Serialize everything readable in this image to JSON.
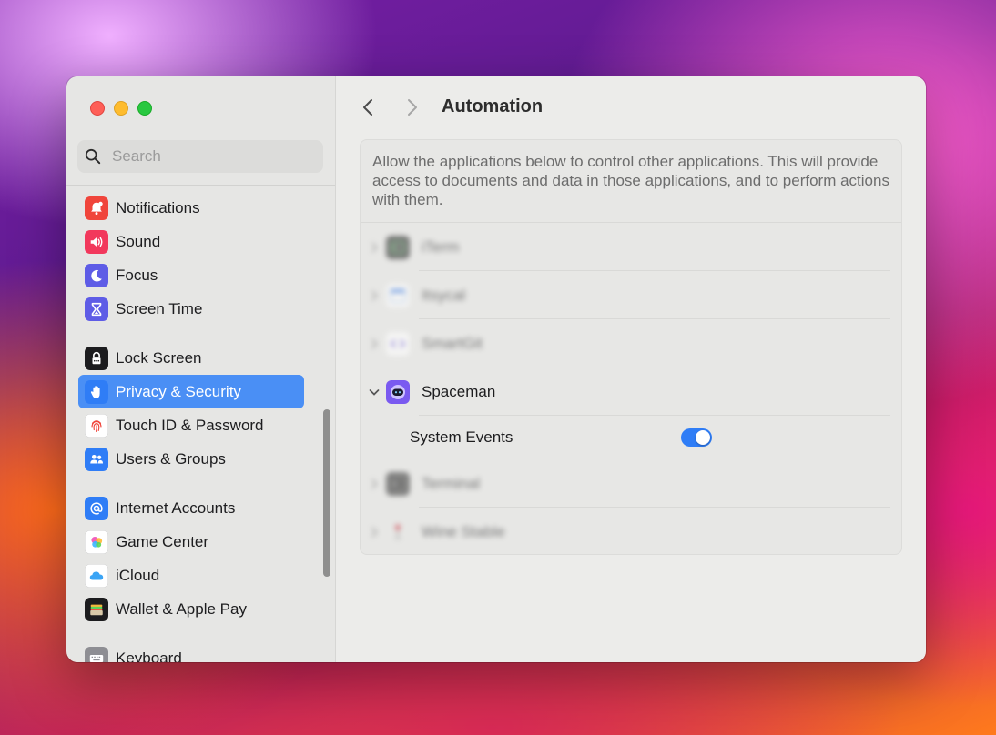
{
  "sidebar": {
    "search_placeholder": "Search",
    "items": [
      {
        "label": "Notifications",
        "icon": "bell-icon",
        "color": "#f0453b"
      },
      {
        "label": "Sound",
        "icon": "speaker-icon",
        "color": "#f2385c"
      },
      {
        "label": "Focus",
        "icon": "moon-icon",
        "color": "#5e5ce6"
      },
      {
        "label": "Screen Time",
        "icon": "hourglass-icon",
        "color": "#5e5ce6"
      },
      {
        "label": "Lock Screen",
        "icon": "lock-icon",
        "color": "#1c1c1e"
      },
      {
        "label": "Privacy & Security",
        "icon": "hand-icon",
        "color": "#2f7df6",
        "active": true
      },
      {
        "label": "Touch ID & Password",
        "icon": "fingerprint-icon",
        "color": "#ffffff"
      },
      {
        "label": "Users & Groups",
        "icon": "users-icon",
        "color": "#2f7df6"
      },
      {
        "label": "Internet Accounts",
        "icon": "at-icon",
        "color": "#2f7df6"
      },
      {
        "label": "Game Center",
        "icon": "game-center-icon",
        "color": "#ffffff"
      },
      {
        "label": "iCloud",
        "icon": "cloud-icon",
        "color": "#ffffff"
      },
      {
        "label": "Wallet & Apple Pay",
        "icon": "wallet-icon",
        "color": "#1c1c1e"
      },
      {
        "label": "Keyboard",
        "icon": "keyboard-icon",
        "color": "#8e8e93"
      }
    ]
  },
  "header": {
    "title": "Automation"
  },
  "main": {
    "description": "Allow the applications below to control other applications. This will provide access to documents and data in those applications, and to perform actions with them.",
    "apps": [
      {
        "name": "iTerm",
        "icon": "iterm-icon",
        "blurred": true
      },
      {
        "name": "Itsycal",
        "icon": "calendar-icon",
        "blurred": true
      },
      {
        "name": "SmartGit",
        "icon": "smartgit-icon",
        "blurred": true
      },
      {
        "name": "Spaceman",
        "icon": "spaceman-icon",
        "blurred": false,
        "expanded": true,
        "children": [
          {
            "name": "System Events",
            "enabled": true
          }
        ]
      },
      {
        "name": "Terminal",
        "icon": "terminal-icon",
        "blurred": true
      },
      {
        "name": "Wine Stable",
        "icon": "wine-icon",
        "blurred": true
      }
    ]
  },
  "colors": {
    "accent": "#2f7df6",
    "sidebar_selection": "#4a8ff5"
  }
}
